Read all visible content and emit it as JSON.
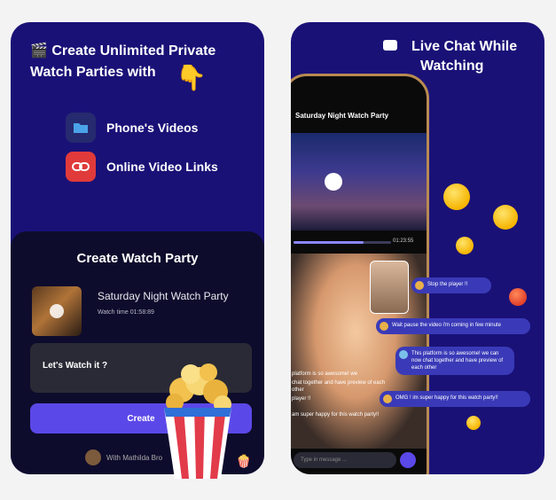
{
  "left_card": {
    "header_line1": "🎬 Create Unlimited Private",
    "header_line2": "Watch Parties with",
    "features": [
      {
        "label": "Phone's Videos",
        "icon": "folder-icon",
        "color": "#262a6e"
      },
      {
        "label": "Online Video Links",
        "icon": "link-icon",
        "color": "#e03a3a"
      }
    ],
    "panel": {
      "title": "Create Watch Party",
      "party_name": "Saturday Night Watch Party",
      "watch_time": "Watch time 01:58:89",
      "message_value": "Let's Watch it ?",
      "create_label": "Create",
      "with_text": "With Mathilda Bro"
    }
  },
  "right_card": {
    "header_line1": "Live Chat While",
    "header_line2": "Watching",
    "phone": {
      "title": "Saturday Night Watch Party",
      "progress": 0.72,
      "timecode": "01:23:55",
      "chat_input_placeholder": "Type in message ...",
      "chat_lines": [
        "platform is so awesome! we",
        "chat together and have preview of each other",
        "player !!",
        "am super happy for this watch party!!"
      ]
    },
    "bubbles": [
      "Stop the player !!",
      "Wait pause the video i'm coming in few minute",
      "This platform is so awesome! we can now chat together and have preview of each other",
      "OMG ! im super happy for this watch party!!"
    ]
  },
  "colors": {
    "card_bg": "#1a1177",
    "panel_bg": "#0e0c2c",
    "accent": "#5b48e8",
    "bubble": "#3a3ab8"
  }
}
